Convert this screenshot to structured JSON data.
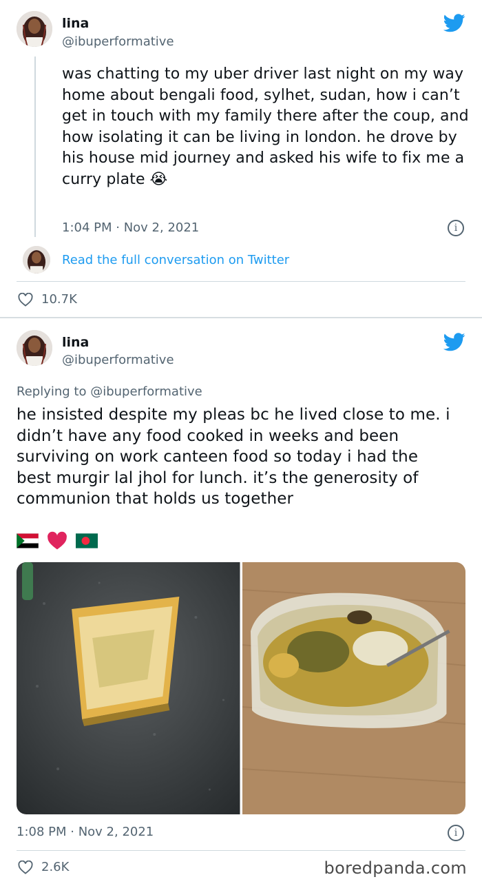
{
  "tweets": [
    {
      "author": {
        "name": "lina",
        "handle": "@ibuperformative"
      },
      "text": "was chatting to my uber driver last night on my way home about bengali food, sylhet, sudan, how i can’t get in touch with my family there after the coup, and how isolating it can be living in london. he drove by his house mid journey and asked his wife to fix me a curry plate",
      "emoji": "😭",
      "timestamp": "1:04 PM · Nov 2, 2021",
      "thread_link": "Read the full conversation on Twitter",
      "likes": "10.7K"
    },
    {
      "author": {
        "name": "lina",
        "handle": "@ibuperformative"
      },
      "replying_to_prefix": "Replying to",
      "replying_to_handle": "@ibuperformative",
      "text": "he insisted despite my pleas bc he lived close to me. i didn’t have any food cooked in weeks and been surviving on work canteen food so today i had the best murgir lal jhol for lunch. it’s the generosity of communion that holds us together",
      "emoji_row": [
        "sudan-flag",
        "red-heart",
        "bangladesh-flag"
      ],
      "timestamp": "1:08 PM · Nov 2, 2021",
      "likes": "2.6K"
    }
  ],
  "watermark": "boredpanda.com",
  "colors": {
    "twitter_blue": "#1d9bf0",
    "muted": "#536471",
    "heart_red": "#e0245e"
  }
}
